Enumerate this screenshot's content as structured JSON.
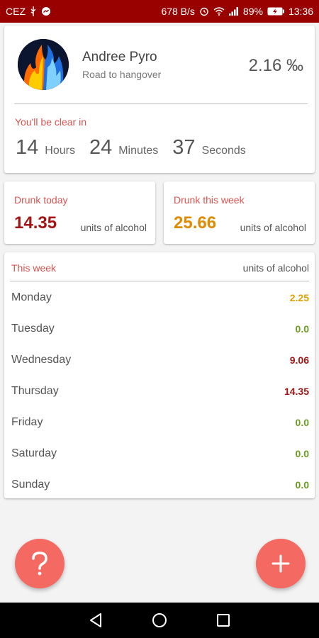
{
  "status_bar": {
    "carrier": "CEZ",
    "net_speed": "678 B/s",
    "battery": "89%",
    "time": "13:36"
  },
  "profile": {
    "name": "Andree Pyro",
    "subtitle": "Road to hangover",
    "bac": "2.16 ‰",
    "clear_label": "You'll be clear in",
    "hours": "14",
    "hours_label": "Hours",
    "minutes": "24",
    "minutes_label": "Minutes",
    "seconds": "37",
    "seconds_label": "Seconds"
  },
  "today": {
    "label": "Drunk today",
    "value": "14.35",
    "unit": "units of alcohol",
    "color": "#a31515"
  },
  "week_total": {
    "label": "Drunk this week",
    "value": "25.66",
    "unit": "units of alcohol",
    "color": "#e08a00"
  },
  "week": {
    "title": "This week",
    "unit_header": "units of alcohol",
    "days": [
      {
        "name": "Monday",
        "value": "2.25",
        "color": "#e0a000"
      },
      {
        "name": "Tuesday",
        "value": "0.0",
        "color": "#6b9e1f"
      },
      {
        "name": "Wednesday",
        "value": "9.06",
        "color": "#a31515"
      },
      {
        "name": "Thursday",
        "value": "14.35",
        "color": "#a31515"
      },
      {
        "name": "Friday",
        "value": "0.0",
        "color": "#6b9e1f"
      },
      {
        "name": "Saturday",
        "value": "0.0",
        "color": "#6b9e1f"
      },
      {
        "name": "Sunday",
        "value": "0.0",
        "color": "#6b9e1f"
      }
    ]
  },
  "fab": {
    "help_icon": "question-mark-icon",
    "add_icon": "plus-icon",
    "accent": "#f46a62"
  },
  "nav": {
    "back_icon": "back-triangle-icon",
    "home_icon": "home-circle-icon",
    "recents_icon": "recents-square-icon"
  }
}
